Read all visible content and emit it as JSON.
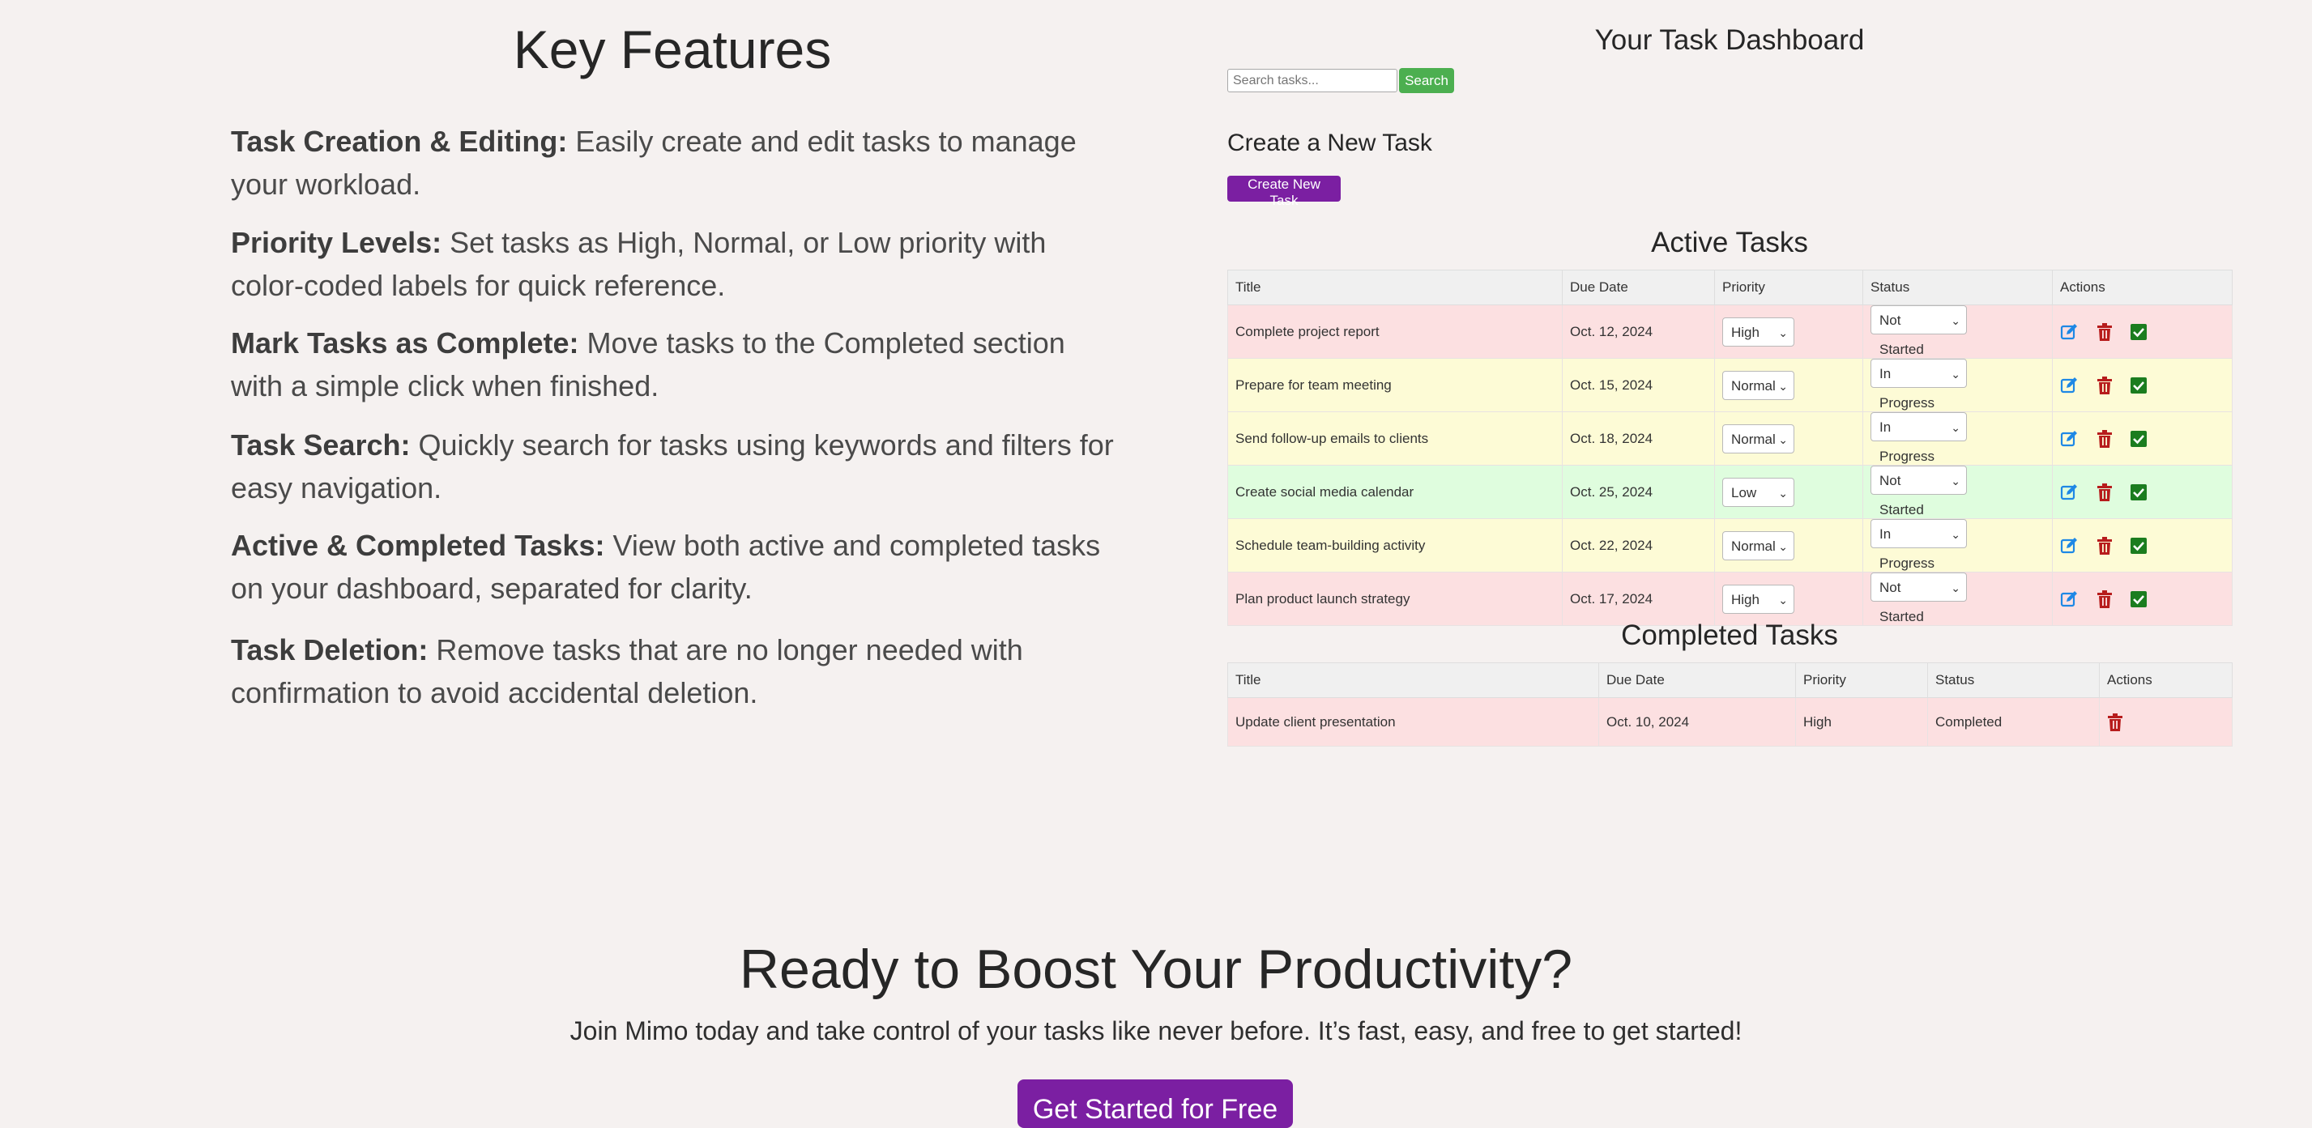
{
  "features": {
    "title": "Key Features",
    "items": [
      {
        "label": "Task Creation & Editing:",
        "text": " Easily create and edit tasks to manage your workload."
      },
      {
        "label": "Priority Levels:",
        "text": " Set tasks as High, Normal, or Low priority with color-coded labels for quick reference."
      },
      {
        "label": "Mark Tasks as Complete:",
        "text": " Move tasks to the Completed section with a simple click when finished."
      },
      {
        "label": "Task Search:",
        "text": " Quickly search for tasks using keywords and filters for easy navigation."
      },
      {
        "label": "Active & Completed Tasks:",
        "text": " View both active and completed tasks on your dashboard, separated for clarity."
      },
      {
        "label": "Task Deletion:",
        "text": " Remove tasks that are no longer needed with confirmation to avoid accidental deletion."
      }
    ]
  },
  "dashboard": {
    "title": "Your Task Dashboard",
    "search_placeholder": "Search tasks...",
    "search_label": "Search",
    "create_heading": "Create a New Task",
    "create_label": "Create New Task",
    "active_title": "Active Tasks",
    "completed_title": "Completed Tasks",
    "columns": {
      "title": "Title",
      "due": "Due Date",
      "priority": "Priority",
      "status": "Status",
      "actions": "Actions"
    },
    "active_tasks": [
      {
        "title": "Complete project report",
        "due": "Oct. 12, 2024",
        "priority": "High",
        "status": "Not Started"
      },
      {
        "title": "Prepare for team meeting",
        "due": "Oct. 15, 2024",
        "priority": "Normal",
        "status": "In Progress"
      },
      {
        "title": "Send follow-up emails to clients",
        "due": "Oct. 18, 2024",
        "priority": "Normal",
        "status": "In Progress"
      },
      {
        "title": "Create social media calendar",
        "due": "Oct. 25, 2024",
        "priority": "Low",
        "status": "Not Started"
      },
      {
        "title": "Schedule team-building activity",
        "due": "Oct. 22, 2024",
        "priority": "Normal",
        "status": "In Progress"
      },
      {
        "title": "Plan product launch strategy",
        "due": "Oct. 17, 2024",
        "priority": "High",
        "status": "Not Started"
      }
    ],
    "completed_tasks": [
      {
        "title": "Update client presentation",
        "due": "Oct. 10, 2024",
        "priority": "High",
        "status": "Completed"
      }
    ]
  },
  "cta": {
    "title": "Ready to Boost Your Productivity?",
    "subtitle": "Join Mimo today and take control of your tasks like never before. It’s fast, easy, and free to get started!",
    "button_label": "Get Started for Free"
  },
  "colors": {
    "high": "#fce0e1",
    "normal": "#fdfbd6",
    "low": "#dffdde",
    "search_button": "#4caf50",
    "brand_purple": "#7b1fa2",
    "edit_icon": "#1e88e5",
    "delete_icon": "#b71c1c",
    "complete_icon": "#1b7d1f"
  },
  "icons": {
    "edit": "edit-icon",
    "delete": "trash-icon",
    "complete": "check-square-icon",
    "dropdown": "chevron-down-icon"
  }
}
